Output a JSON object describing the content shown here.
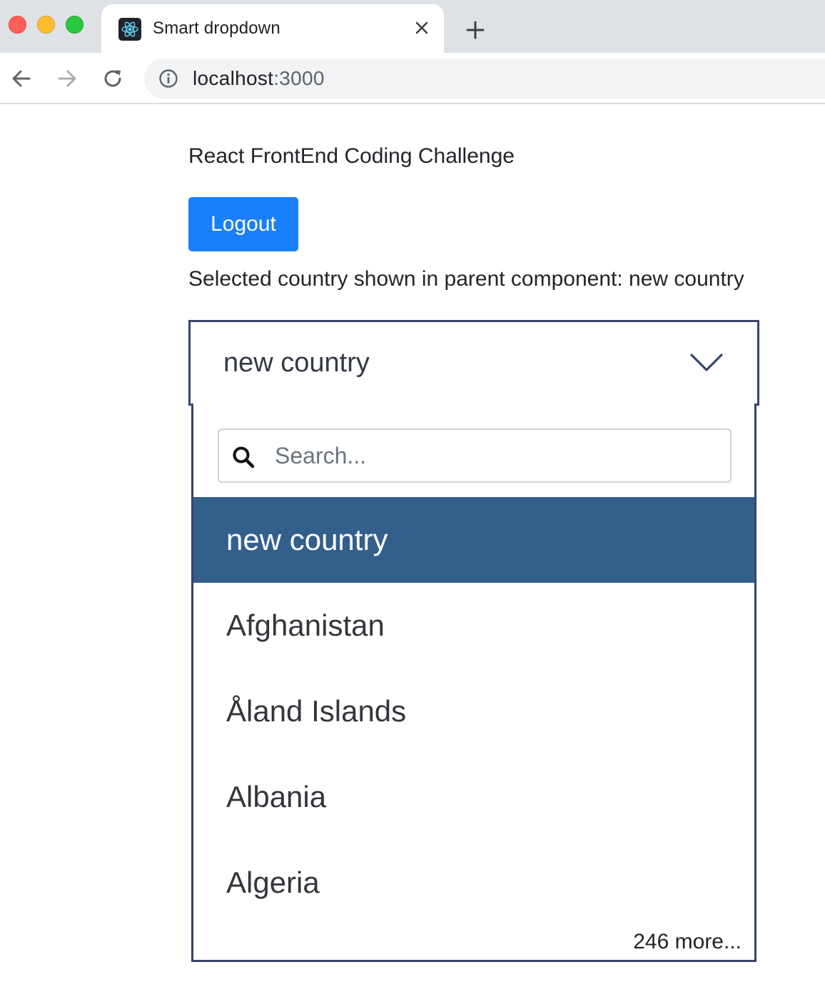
{
  "browser": {
    "tab_title": "Smart dropdown",
    "url_host": "localhost",
    "url_port": ":3000",
    "favicon": "react-icon"
  },
  "page": {
    "title": "React FrontEnd Coding Challenge",
    "logout_label": "Logout",
    "selected_text": "Selected country shown in parent component: new country"
  },
  "dropdown": {
    "selected_value": "new country",
    "search_placeholder": "Search...",
    "options": [
      {
        "label": "new country",
        "selected": true
      },
      {
        "label": "Afghanistan",
        "selected": false
      },
      {
        "label": "Åland Islands",
        "selected": false
      },
      {
        "label": "Albania",
        "selected": false
      },
      {
        "label": "Algeria",
        "selected": false
      }
    ],
    "more_label": "246 more..."
  },
  "colors": {
    "primary_button": "#1a7ffb",
    "dropdown_border": "#36456a",
    "selected_option_bg": "#335f8d"
  }
}
